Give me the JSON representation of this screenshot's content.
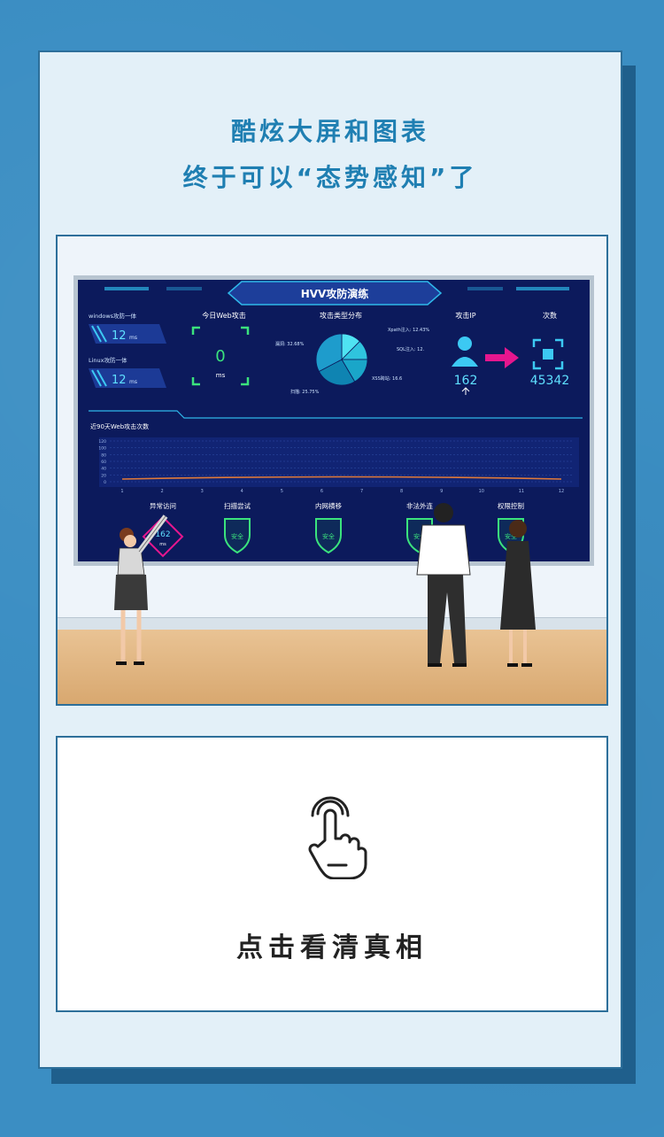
{
  "header": {
    "line1": "酷炫大屏和图表",
    "line2": "终于可以“态势感知”了"
  },
  "dashboard": {
    "title": "HVV攻防演练",
    "windows_label": "windows攻防一体",
    "windows_value": "12",
    "windows_unit": "ms",
    "linux_label": "Linux攻防一体",
    "linux_value": "12",
    "linux_unit": "ms",
    "web_today_label": "今日Web攻击",
    "web_today_value": "0",
    "web_today_unit": "ms",
    "attack_type_label": "攻击类型分布",
    "pie": [
      {
        "label": "Xpath注入: 12.43%",
        "value": 12.43,
        "color": "#4fe3f2"
      },
      {
        "label": "SQL注入: 12.",
        "value": 12.5,
        "color": "#2fc4de"
      },
      {
        "label": "XSS跨站: 16.6",
        "value": 16.6,
        "color": "#1aa6c9"
      },
      {
        "label": "扫描: 25.75%",
        "value": 25.75,
        "color": "#0f84b2"
      },
      {
        "label": "漏洞: 32.68%",
        "value": 32.68,
        "color": "#1e9ccc"
      }
    ],
    "attack_ip_label": "攻击IP",
    "attack_ip_value": "162",
    "count_label": "次数",
    "count_value": "45342",
    "trend_label": "近90天Web攻击次数",
    "trend_yticks": [
      "120",
      "100",
      "80",
      "60",
      "40",
      "20",
      "0"
    ],
    "trend_xticks": [
      "1",
      "2",
      "3",
      "4",
      "5",
      "6",
      "7",
      "8",
      "9",
      "10",
      "11",
      "12"
    ],
    "status": [
      {
        "label": "异常访问",
        "value": "162",
        "unit": "ms"
      },
      {
        "label": "扫描尝试",
        "value": "安全"
      },
      {
        "label": "内网横移",
        "value": "安全"
      },
      {
        "label": "非法外连",
        "value": "安全"
      },
      {
        "label": "权限控制",
        "value": "安全"
      }
    ]
  },
  "cta": {
    "label": "点击看清真相",
    "icon": "tap-hand-icon"
  }
}
